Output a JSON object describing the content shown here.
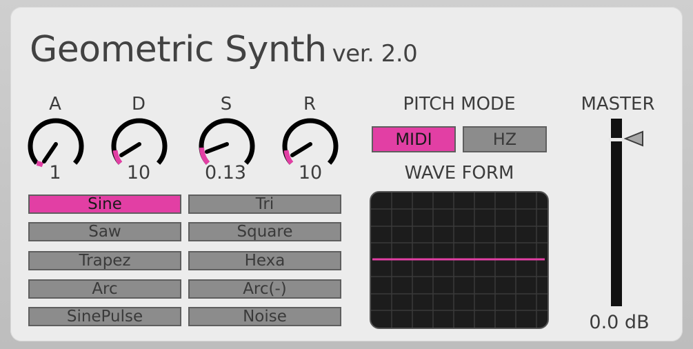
{
  "header": {
    "title": "Geometric Synth",
    "version": "ver. 2.0"
  },
  "envelope": {
    "knobs": [
      {
        "label": "A",
        "value": "1"
      },
      {
        "label": "D",
        "value": "10"
      },
      {
        "label": "S",
        "value": "0.13"
      },
      {
        "label": "R",
        "value": "10"
      }
    ],
    "accent": "#e23fa4"
  },
  "waveforms": {
    "selected": "Sine",
    "buttons": [
      "Sine",
      "Tri",
      "Saw",
      "Square",
      "Trapez",
      "Hexa",
      "Arc",
      "Arc(-)",
      "SinePulse",
      "Noise"
    ]
  },
  "pitch_mode": {
    "label": "PITCH MODE",
    "options": [
      "MIDI",
      "HZ"
    ],
    "selected": "MIDI"
  },
  "wave_form": {
    "label": "WAVE FORM"
  },
  "master": {
    "label": "MASTER",
    "value": "0.0 dB",
    "level": 0.9
  }
}
